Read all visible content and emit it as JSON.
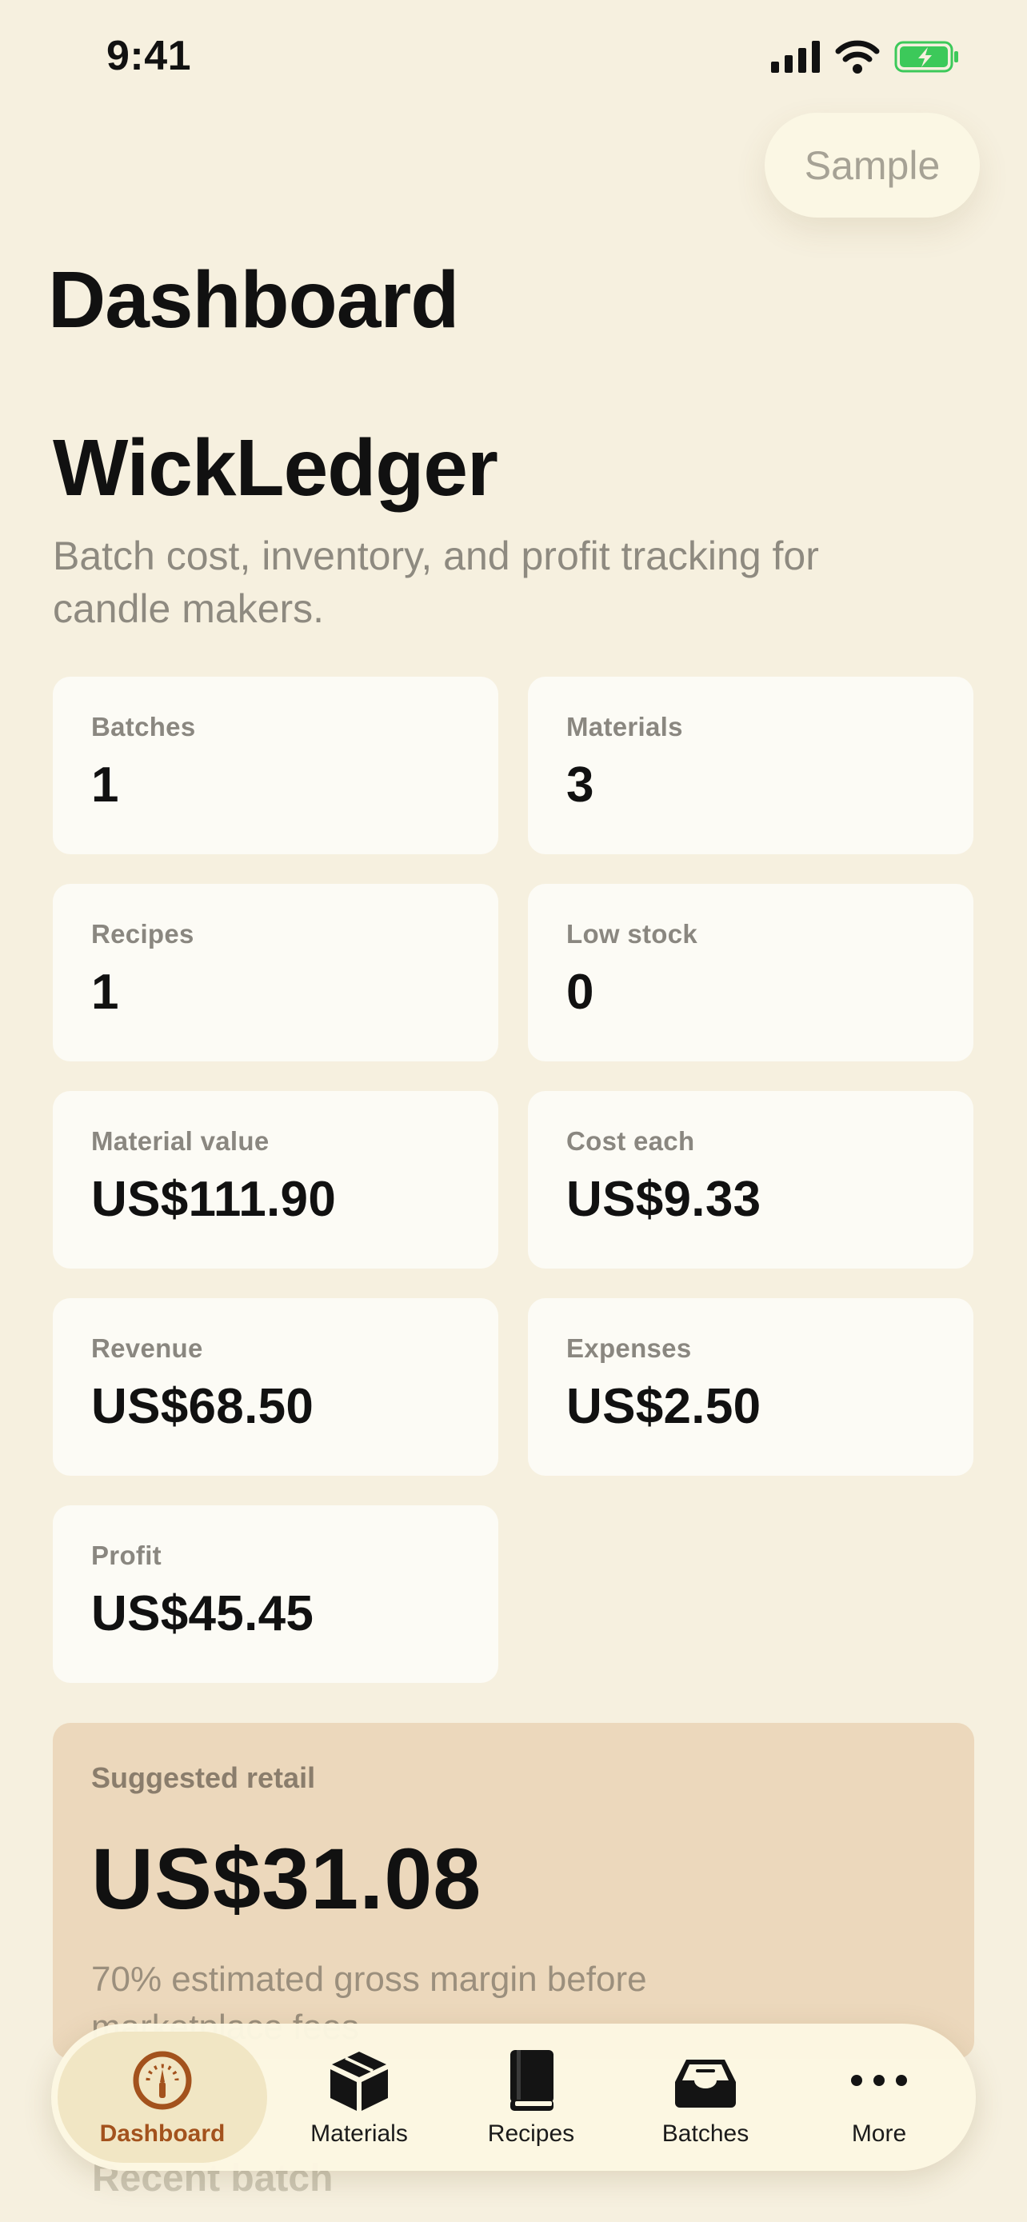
{
  "status_bar": {
    "time": "9:41"
  },
  "toolbar": {
    "sample_label": "Sample"
  },
  "nav": {
    "title": "Dashboard"
  },
  "header": {
    "app_name": "WickLedger",
    "subtitle": "Batch cost, inventory, and profit tracking for candle makers."
  },
  "stats": [
    {
      "label": "Batches",
      "value": "1"
    },
    {
      "label": "Materials",
      "value": "3"
    },
    {
      "label": "Recipes",
      "value": "1"
    },
    {
      "label": "Low stock",
      "value": "0"
    },
    {
      "label": "Material value",
      "value": "US$111.90"
    },
    {
      "label": "Cost each",
      "value": "US$9.33"
    },
    {
      "label": "Revenue",
      "value": "US$68.50"
    },
    {
      "label": "Expenses",
      "value": "US$2.50"
    },
    {
      "label": "Profit",
      "value": "US$45.45"
    }
  ],
  "retail": {
    "label": "Suggested retail",
    "value": "US$31.08",
    "note": "70% estimated gross margin before marketplace fees"
  },
  "recent": {
    "heading": "Recent batch"
  },
  "tabs": [
    {
      "label": "Dashboard",
      "icon": "gauge-icon"
    },
    {
      "label": "Materials",
      "icon": "box-icon"
    },
    {
      "label": "Recipes",
      "icon": "book-icon"
    },
    {
      "label": "Batches",
      "icon": "tray-icon"
    },
    {
      "label": "More",
      "icon": "ellipsis-icon"
    }
  ],
  "colors": {
    "background": "#f6f0df",
    "card": "#fcfbf5",
    "retail_card": "#ecd8bc",
    "accent": "#a3521d",
    "battery": "#3cc95a"
  }
}
